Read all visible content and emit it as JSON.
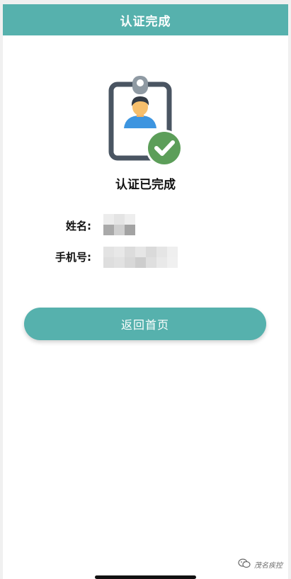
{
  "header": {
    "title": "认证完成"
  },
  "status": {
    "icon": "id-badge-verified-icon",
    "text": "认证已完成"
  },
  "info": {
    "name_label": "姓名:",
    "phone_label": "手机号:"
  },
  "actions": {
    "home_button_label": "返回首页"
  },
  "watermark": {
    "icon": "wechat-icon",
    "text": "茂名疾控"
  },
  "colors": {
    "accent": "#56b1ad",
    "badge_frame": "#4a5562",
    "check_green": "#5c9e59"
  }
}
